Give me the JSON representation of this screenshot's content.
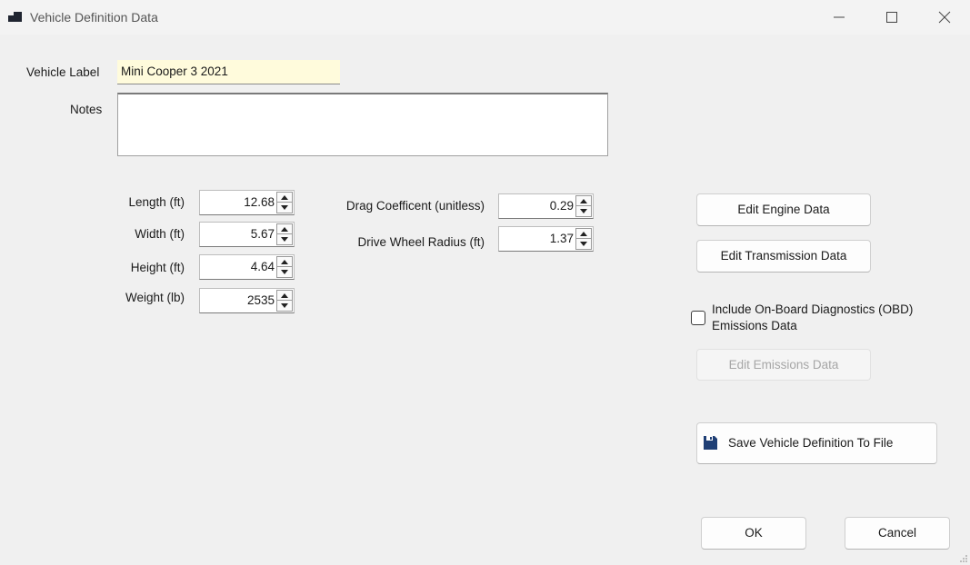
{
  "window": {
    "title": "Vehicle Definition Data",
    "icon": "app-window-icon"
  },
  "form": {
    "vehicle_label_caption": "Vehicle Label",
    "vehicle_label_value": "Mini Cooper 3 2021",
    "notes_caption": "Notes",
    "notes_value": ""
  },
  "dimensions": [
    {
      "label": "Length (ft)",
      "value": "12.68"
    },
    {
      "label": "Width (ft)",
      "value": "5.67"
    },
    {
      "label": "Height (ft)",
      "value": "4.64"
    },
    {
      "label": "Weight (lb)",
      "value": "2535"
    }
  ],
  "aero": [
    {
      "label": "Drag Coefficent (unitless)",
      "value": "0.29"
    },
    {
      "label": "Drive Wheel  Radius (ft)",
      "value": "1.37"
    }
  ],
  "actions": {
    "edit_engine": "Edit Engine Data",
    "edit_transmission": "Edit Transmission Data",
    "obd_checkbox_line1": "Include On-Board Diagnostics (OBD)",
    "obd_checkbox_line2": "Emissions Data",
    "obd_checked": false,
    "edit_emissions": "Edit Emissions Data",
    "save_to_file": "Save Vehicle Definition To File",
    "save_icon": "floppy-disk-icon",
    "ok": "OK",
    "cancel": "Cancel"
  },
  "colors": {
    "vehicle_label_bg": "#fffbdc",
    "save_icon": "#1f3f75"
  }
}
